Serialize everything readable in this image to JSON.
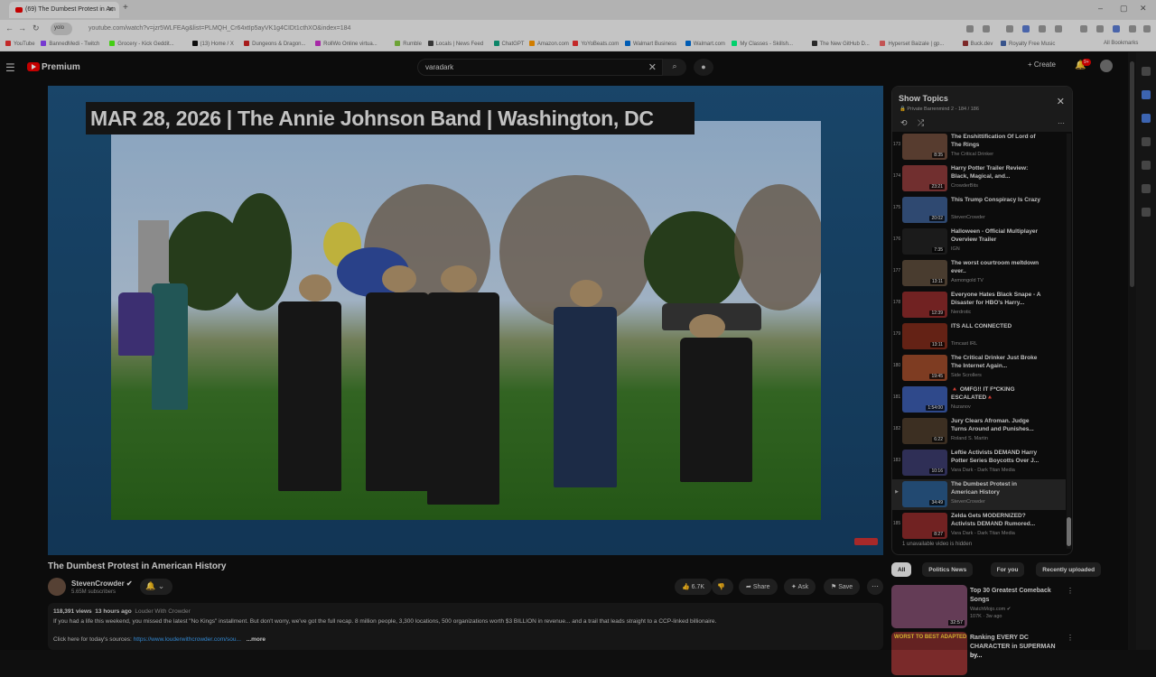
{
  "browser": {
    "tab_title": "(69) The Dumbest Protest in Am",
    "url": "youtube.com/watch?v=jzr5WLFEAg&list=PLMQH_Cr64xtIp5ayVK1g4CIDt1cthXO&index=184",
    "url_chip": "yolo",
    "bookmarks": [
      {
        "label": "YouTube",
        "color": "#e33"
      },
      {
        "label": "BannedMedi - Twitch",
        "color": "#9146ff"
      },
      {
        "label": "Grocery - Kick Geddit...",
        "color": "#53fc18"
      },
      {
        "label": "(13) Home / X",
        "color": "#111"
      },
      {
        "label": "Dungeons & Dragon...",
        "color": "#c22"
      },
      {
        "label": "RollWo Online virtua...",
        "color": "#c3c"
      },
      {
        "label": "Rumble",
        "color": "#85c742"
      },
      {
        "label": "Locals | News Feed",
        "color": "#444"
      },
      {
        "label": "ChatGPT",
        "color": "#10a37f"
      },
      {
        "label": "Amazon.com",
        "color": "#f90"
      },
      {
        "label": "YoYoBeats.com",
        "color": "#e33"
      },
      {
        "label": "Walmart Business",
        "color": "#0071dc"
      },
      {
        "label": "Walmart.com",
        "color": "#0071dc"
      },
      {
        "label": "My Classes - Skillsh...",
        "color": "#00ff84"
      },
      {
        "label": "The New GitHub D...",
        "color": "#333"
      },
      {
        "label": "Hyperset Baizale | gp...",
        "color": "#e66"
      },
      {
        "label": "Buck.dev",
        "color": "#933"
      },
      {
        "label": "Royalty Free Music",
        "color": "#46a"
      }
    ],
    "all_bookmarks": "All Bookmarks"
  },
  "header": {
    "brand": "Premium",
    "search_value": "varadark",
    "create_label": "Create",
    "notif_count": "9+"
  },
  "video": {
    "banner_text": "MAR 28, 2026 | The Annie Johnson Band | Washington, DC",
    "title": "The Dumbest Protest in American History",
    "channel": "StevenCrowder",
    "subscribers": "5.65M subscribers",
    "likes": "6.7K",
    "share": "Share",
    "ask": "Ask",
    "save": "Save",
    "views": "118,391 views",
    "age": "13 hours ago",
    "tagline": "Louder With Crowder",
    "description": "If you had a life this weekend, you missed the latest \"No Kings\" installment. But don't worry, we've got the full recap. 8 million people, 3,300 locations, 500 organizations worth $3 BILLION in revenue... and a trail that leads straight to a CCP-linked billionaire.",
    "link_prefix": "Click here for today's sources:",
    "link": "https://www.louderwithcrowder.com/sou...",
    "more": "...more"
  },
  "playlist": {
    "title": "Show Topics",
    "subtitle": "Private Barrenmind 2 - 184 / 186",
    "unavailable": "1 unavailable video is hidden",
    "items": [
      {
        "idx": "173",
        "title": "The Enshittification Of Lord of The Rings",
        "channel": "The Critical Drinker",
        "dur": "8:35",
        "color": "#6b4a3a"
      },
      {
        "idx": "174",
        "title": "Harry Potter Trailer Review: Black, Magical, and...",
        "channel": "CrowderBits",
        "dur": "23:21",
        "color": "#8a3a3a"
      },
      {
        "idx": "175",
        "title": "This Trump Conspiracy Is Crazy",
        "channel": "StevenCrowder",
        "dur": "20:02",
        "color": "#3a5a8a"
      },
      {
        "idx": "176",
        "title": "Halloween - Official Multiplayer Overview Trailer",
        "channel": "IGN",
        "dur": "7:35",
        "color": "#222"
      },
      {
        "idx": "177",
        "title": "The worst courtroom meltdown ever..",
        "channel": "Asmongold TV",
        "dur": "13:11",
        "color": "#5a4a3a"
      },
      {
        "idx": "178",
        "title": "Everyone Hates Black Snape - A Disaster for HBO's Harry...",
        "channel": "Nerdrotic",
        "dur": "12:39",
        "color": "#8a2a2a"
      },
      {
        "idx": "179",
        "title": "ITS ALL CONNECTED",
        "channel": "Timcast IRL",
        "dur": "13:11",
        "color": "#7a2a1a"
      },
      {
        "idx": "180",
        "title": "The Critical Drinker Just Broke The Internet Again...",
        "channel": "Side Scrollers",
        "dur": "19:45",
        "color": "#9a4a2a"
      },
      {
        "idx": "181",
        "title": "🔺 OMFG!! IT F*CKING ESCALATED🔺",
        "channel": "Nuzanov",
        "dur": "1:54:00",
        "color": "#3a5aaa"
      },
      {
        "idx": "182",
        "title": "Jury Clears Afroman. Judge Turns Around and Punishes...",
        "channel": "Roland S. Martin",
        "dur": "6:22",
        "color": "#4a3a2a"
      },
      {
        "idx": "183",
        "title": "Leftie Activists DEMAND Harry Potter Series Boycotts Over J...",
        "channel": "Vara Dark - Dark Titan Media",
        "dur": "10:16",
        "color": "#3a3a6a"
      },
      {
        "idx": "▶",
        "title": "The Dumbest Protest in American History",
        "channel": "StevenCrowder",
        "dur": "34:49",
        "color": "#2a5a8a",
        "active": true
      },
      {
        "idx": "185",
        "title": "Zelda Gets MODERNIZED? Activists DEMAND Rumored...",
        "channel": "Vara Dark - Dark Titan Media",
        "dur": "8:27",
        "color": "#8a2a2a"
      }
    ]
  },
  "chips": [
    "All",
    "Politics News",
    "For you",
    "Recently uploaded"
  ],
  "recommendations": [
    {
      "title": "Top 30 Greatest Comeback Songs",
      "channel": "WatchMojo.com ✔",
      "meta": "107K · 3w ago",
      "dur": "32:57",
      "color": "#7a4a6a"
    },
    {
      "title": "Ranking EVERY DC CHARACTER in SUPERMAN by...",
      "channel": "",
      "meta": "",
      "dur": "",
      "thumb_text": "WORST TO BEST ADAPTED",
      "color": "#7a2a2a"
    }
  ]
}
